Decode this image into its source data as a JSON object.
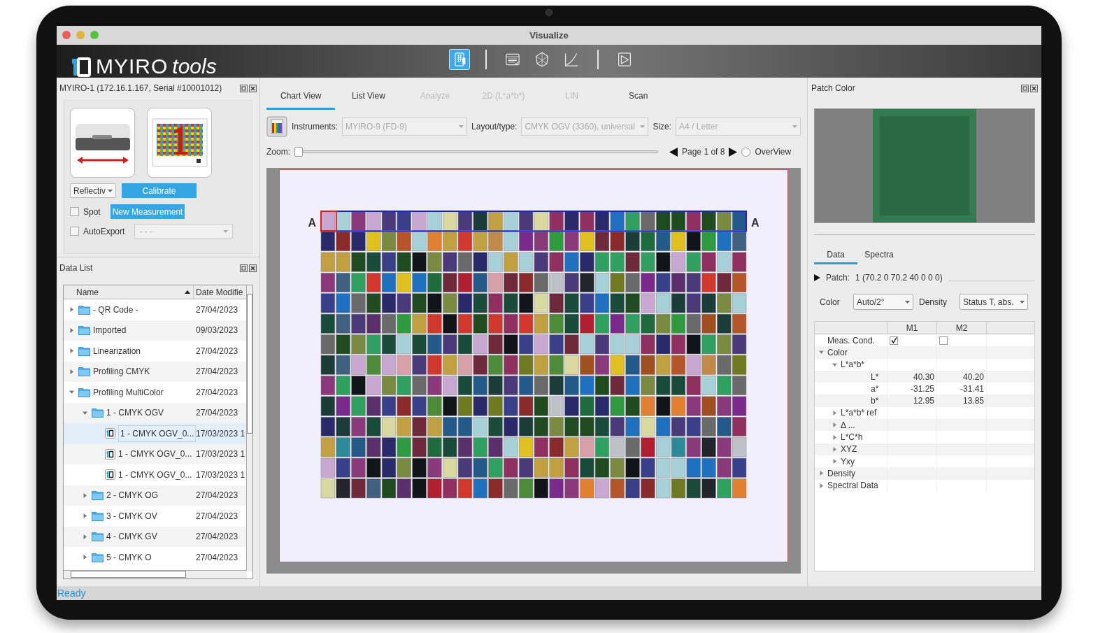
{
  "window": {
    "title": "Visualize"
  },
  "brand": {
    "name": "MYIRO",
    "suffix": "tools"
  },
  "toolbar": [
    [
      {
        "kind": "chart",
        "selected": true
      }
    ],
    [
      {
        "kind": "list",
        "selected": false
      },
      {
        "kind": "gamut",
        "selected": false
      },
      {
        "kind": "curve",
        "selected": false
      }
    ],
    [
      {
        "kind": "scan",
        "selected": false
      }
    ]
  ],
  "instrument_panel": {
    "title": "MYIRO-1 (172.16.1.167, Serial #10001012)",
    "mode": "Reflectiv",
    "calibrate": "Calibrate",
    "spot": {
      "label": "Spot",
      "checked": false
    },
    "new_measurement": "New Measurement",
    "auto_export": {
      "label": "AutoExport",
      "checked": false,
      "value": "- - -"
    }
  },
  "data_list": {
    "title": "Data List",
    "columns": [
      "Name",
      "Date Modifie"
    ],
    "rows": [
      {
        "kind": "folder",
        "name": "- QR Code -",
        "date": "27/04/2023",
        "expanded": false,
        "selected": false
      },
      {
        "kind": "folder",
        "name": "Imported",
        "date": "09/03/2023",
        "expanded": false,
        "selected": false
      },
      {
        "kind": "folder",
        "name": "Linearization",
        "date": "27/04/2023",
        "expanded": false,
        "selected": false
      },
      {
        "kind": "folder",
        "name": "Profiling CMYK",
        "date": "27/04/2023",
        "expanded": false,
        "selected": false
      },
      {
        "kind": "folder",
        "name": "Profiling MultiColor",
        "date": "27/04/2023",
        "expanded": true,
        "selected": false,
        "children": [
          {
            "kind": "folder",
            "name": "1 - CMYK OGV",
            "date": "27/04/2023",
            "expanded": true,
            "selected": false,
            "children": [
              {
                "kind": "file",
                "name": "1 - CMYK OGV_0...",
                "date": "17/03/2023 1",
                "selected": true
              },
              {
                "kind": "file",
                "name": "1 - CMYK OGV_0...",
                "date": "17/03/2023 1",
                "selected": false
              },
              {
                "kind": "file",
                "name": "1 - CMYK OGV_0...",
                "date": "17/03/2023 1",
                "selected": false
              }
            ]
          },
          {
            "kind": "folder",
            "name": "2 - CMYK OG",
            "date": "27/04/2023",
            "expanded": false,
            "selected": false
          },
          {
            "kind": "folder",
            "name": "3 - CMYK OV",
            "date": "27/04/2023",
            "expanded": false,
            "selected": false
          },
          {
            "kind": "folder",
            "name": "4 - CMYK GV",
            "date": "27/04/2023",
            "expanded": false,
            "selected": false
          },
          {
            "kind": "folder",
            "name": "5 - CMYK O",
            "date": "27/04/2023",
            "expanded": false,
            "selected": false
          }
        ]
      }
    ]
  },
  "center": {
    "tabs": [
      {
        "label": "Chart View",
        "selected": true,
        "disabled": false
      },
      {
        "label": "List View",
        "selected": false,
        "disabled": false
      },
      {
        "label": "Analyze",
        "selected": false,
        "disabled": true
      },
      {
        "label": "2D (L*a*b*)",
        "selected": false,
        "disabled": true
      },
      {
        "label": "LIN",
        "selected": false,
        "disabled": true
      },
      {
        "label": "Scan",
        "selected": false,
        "disabled": false
      }
    ],
    "instruments": {
      "label": "Instruments:",
      "value": "MYIRO-9 (FD-9)"
    },
    "layout_type": {
      "label": "Layout/type:",
      "value": "CMYK OGV (3360), universal"
    },
    "size": {
      "label": "Size:",
      "value": "A4 / Letter"
    },
    "zoom": {
      "label": "Zoom:",
      "level": 0
    },
    "page": "Page 1 of 8",
    "overview": {
      "label": "OverView",
      "selected": false
    },
    "chart": {
      "row_labels": [
        "A",
        "A"
      ]
    }
  },
  "patch_panel": {
    "title": "Patch Color",
    "tabs": [
      {
        "label": "Data",
        "selected": true
      },
      {
        "label": "Spectra",
        "selected": false
      }
    ],
    "patch_label": "Patch:",
    "patch_value": "1 (70.2 0 70.2 40 0 0 0)",
    "color_label": "Color",
    "color_value": "Auto/2°",
    "density_label": "Density",
    "density_value": "Status T, abs.",
    "columns": [
      "M1",
      "M2"
    ],
    "rows": [
      {
        "kind": "check",
        "name": "Meas. Cond.",
        "values": [
          true,
          false
        ]
      },
      {
        "kind": "group",
        "name": "Color",
        "expanded": true,
        "children": [
          {
            "kind": "group",
            "name": "L*a*b*",
            "expanded": true,
            "children": [
              {
                "kind": "value",
                "name": "L*",
                "values": [
                  "40.30",
                  "40.20"
                ]
              },
              {
                "kind": "value",
                "name": "a*",
                "values": [
                  "-31.25",
                  "-31.41"
                ]
              },
              {
                "kind": "value",
                "name": "b*",
                "values": [
                  "12.95",
                  "13.85"
                ]
              }
            ]
          },
          {
            "kind": "group",
            "name": "L*a*b* ref",
            "expanded": false
          },
          {
            "kind": "group",
            "name": "Δ ...",
            "expanded": false
          },
          {
            "kind": "group",
            "name": "L*C*h",
            "expanded": false
          },
          {
            "kind": "group",
            "name": "XYZ",
            "expanded": false
          },
          {
            "kind": "group",
            "name": "Yxy",
            "expanded": false
          }
        ]
      },
      {
        "kind": "group",
        "name": "Density",
        "expanded": false
      },
      {
        "kind": "group",
        "name": "Spectral Data",
        "expanded": false
      }
    ]
  },
  "status_bar": "Ready"
}
